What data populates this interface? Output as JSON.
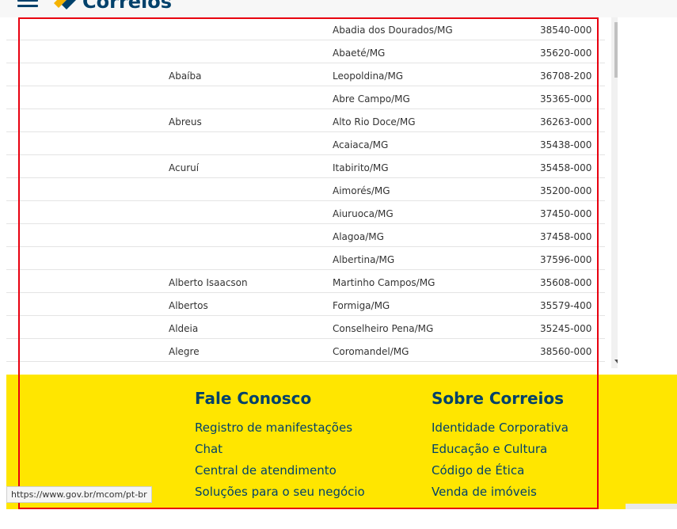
{
  "header": {
    "logo_text": "Correios",
    "brand_colors": {
      "blue": "#00416b",
      "yellow": "#ffe600"
    }
  },
  "table": {
    "rows": [
      {
        "bairro": "",
        "localidade": "Abadia dos Dourados/MG",
        "cep": "38540-000"
      },
      {
        "bairro": "",
        "localidade": "Abaeté/MG",
        "cep": "35620-000"
      },
      {
        "bairro": "Abaíba",
        "localidade": "Leopoldina/MG",
        "cep": "36708-200"
      },
      {
        "bairro": "",
        "localidade": "Abre Campo/MG",
        "cep": "35365-000"
      },
      {
        "bairro": "Abreus",
        "localidade": "Alto Rio Doce/MG",
        "cep": "36263-000"
      },
      {
        "bairro": "",
        "localidade": "Acaiaca/MG",
        "cep": "35438-000"
      },
      {
        "bairro": "Acuruí",
        "localidade": "Itabirito/MG",
        "cep": "35458-000"
      },
      {
        "bairro": "",
        "localidade": "Aimorés/MG",
        "cep": "35200-000"
      },
      {
        "bairro": "",
        "localidade": "Aiuruoca/MG",
        "cep": "37450-000"
      },
      {
        "bairro": "",
        "localidade": "Alagoa/MG",
        "cep": "37458-000"
      },
      {
        "bairro": "",
        "localidade": "Albertina/MG",
        "cep": "37596-000"
      },
      {
        "bairro": "Alberto Isaacson",
        "localidade": "Martinho Campos/MG",
        "cep": "35608-000"
      },
      {
        "bairro": "Albertos",
        "localidade": "Formiga/MG",
        "cep": "35579-400"
      },
      {
        "bairro": "Aldeia",
        "localidade": "Conselheiro Pena/MG",
        "cep": "35245-000"
      },
      {
        "bairro": "Alegre",
        "localidade": "Coromandel/MG",
        "cep": "38560-000"
      }
    ]
  },
  "footer": {
    "fale_conosco": {
      "title": "Fale Conosco",
      "links": [
        "Registro de manifestações",
        "Chat",
        "Central de atendimento",
        "Soluções para o seu negócio"
      ]
    },
    "sobre_correios": {
      "title": "Sobre Correios",
      "links": [
        "Identidade Corporativa",
        "Educação e Cultura",
        "Código de Ética",
        "Venda de imóveis"
      ]
    }
  },
  "status_bar": {
    "url": "https://www.gov.br/mcom/pt-br"
  },
  "highlight": {
    "color": "#e8000f"
  }
}
